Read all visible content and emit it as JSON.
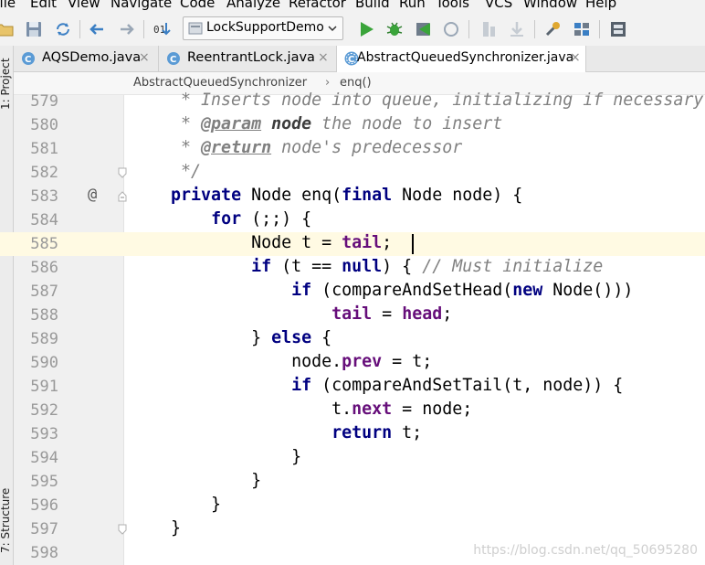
{
  "menu": [
    "File",
    "Edit",
    "View",
    "Navigate",
    "Code",
    "Analyze",
    "Refactor",
    "Build",
    "Run",
    "Tools",
    "VCS",
    "Window",
    "Help"
  ],
  "toolbar": {
    "run_config": "LockSupportDemo",
    "icons": [
      "folder-icon",
      "save-icon",
      "sync-icon",
      "back-icon",
      "forward-icon",
      "build-icon",
      "run-icon",
      "debug-icon",
      "coverage-icon",
      "profile-icon",
      "stop-icon",
      "gradle-icon",
      "settings-icon",
      "structure-icon",
      "sdk-icon"
    ]
  },
  "sidebar": {
    "project_label": "1: Project",
    "structure_label": "7: Structure"
  },
  "tabs": [
    {
      "label": "AQSDemo.java",
      "active": false
    },
    {
      "label": "ReentrantLock.java",
      "active": false
    },
    {
      "label": "AbstractQueuedSynchronizer.java",
      "active": true
    }
  ],
  "tab_close": "×",
  "breadcrumb": {
    "class": "AbstractQueuedSynchronizer",
    "separator": "›",
    "method": "enq()"
  },
  "editor": {
    "current_line": 585,
    "override_marker": "@",
    "lines": [
      {
        "num": "579",
        "text": "     * Inserts node into queue, initializing if necessary."
      },
      {
        "num": "580",
        "text": "     * @param node the node to insert"
      },
      {
        "num": "581",
        "text": "     * @return node's predecessor"
      },
      {
        "num": "582",
        "text": "     */"
      },
      {
        "num": "583",
        "text": "    private Node enq(final Node node) {"
      },
      {
        "num": "584",
        "text": "        for (;;) {"
      },
      {
        "num": "585",
        "text": "            Node t = tail;"
      },
      {
        "num": "586",
        "text": "            if (t == null) { // Must initialize"
      },
      {
        "num": "587",
        "text": "                if (compareAndSetHead(new Node()))"
      },
      {
        "num": "588",
        "text": "                    tail = head;"
      },
      {
        "num": "589",
        "text": "            } else {"
      },
      {
        "num": "590",
        "text": "                node.prev = t;"
      },
      {
        "num": "591",
        "text": "                if (compareAndSetTail(t, node)) {"
      },
      {
        "num": "592",
        "text": "                    t.next = node;"
      },
      {
        "num": "593",
        "text": "                    return t;"
      },
      {
        "num": "594",
        "text": "                }"
      },
      {
        "num": "595",
        "text": "            }"
      },
      {
        "num": "596",
        "text": "        }"
      },
      {
        "num": "597",
        "text": "    }"
      },
      {
        "num": "598",
        "text": ""
      }
    ]
  },
  "watermark": "https://blog.csdn.net/qq_50695280",
  "colors": {
    "keyword": "#000080",
    "field": "#660e7a",
    "comment": "#808080",
    "current_line": "#fffae3",
    "line_number": "#999999"
  }
}
